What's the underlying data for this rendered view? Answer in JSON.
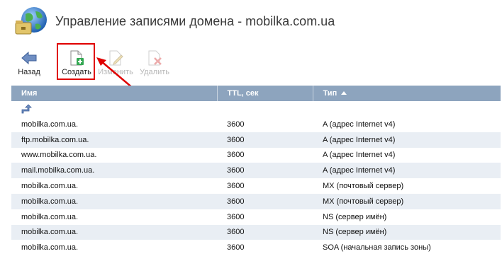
{
  "page": {
    "title": "Управление записями домена - mobilka.com.ua"
  },
  "toolbar": {
    "back_label": "Назад",
    "create_label": "Создать",
    "edit_label": "Изменить",
    "delete_label": "Удалить"
  },
  "table": {
    "columns": [
      "Имя",
      "TTL, сек",
      "Тип"
    ],
    "rows": [
      {
        "name": "mobilka.com.ua.",
        "ttl": "3600",
        "type": "A (адрес Internet v4)",
        "kind": "a"
      },
      {
        "name": "ftp.mobilka.com.ua.",
        "ttl": "3600",
        "type": "A (адрес Internet v4)",
        "kind": "a"
      },
      {
        "name": "www.mobilka.com.ua.",
        "ttl": "3600",
        "type": "A (адрес Internet v4)",
        "kind": "a"
      },
      {
        "name": "mail.mobilka.com.ua.",
        "ttl": "3600",
        "type": "A (адрес Internet v4)",
        "kind": "a"
      },
      {
        "name": "mobilka.com.ua.",
        "ttl": "3600",
        "type": "MX (почтовый сервер)",
        "kind": "mx"
      },
      {
        "name": "mobilka.com.ua.",
        "ttl": "3600",
        "type": "MX (почтовый сервер)",
        "kind": "mx"
      },
      {
        "name": "mobilka.com.ua.",
        "ttl": "3600",
        "type": "NS (сервер имён)",
        "kind": "ns"
      },
      {
        "name": "mobilka.com.ua.",
        "ttl": "3600",
        "type": "NS (сервер имён)",
        "kind": "ns"
      },
      {
        "name": "mobilka.com.ua.",
        "ttl": "3600",
        "type": "SOA (начальная запись зоны)",
        "kind": "soa"
      }
    ]
  },
  "colors": {
    "header_bg": "#8da4be",
    "row_alt": "#e9eef4",
    "type_a": "#2f9a3e",
    "type_ns": "#3a7cc8",
    "type_soa": "#e0704a",
    "highlight": "#e00000"
  },
  "icons": {
    "app": "globe-folder-icon",
    "back": "arrow-left-icon",
    "create": "document-add-icon",
    "edit": "document-edit-icon",
    "delete": "document-delete-icon",
    "up": "folder-up-icon",
    "sort": "sort-asc-icon"
  }
}
